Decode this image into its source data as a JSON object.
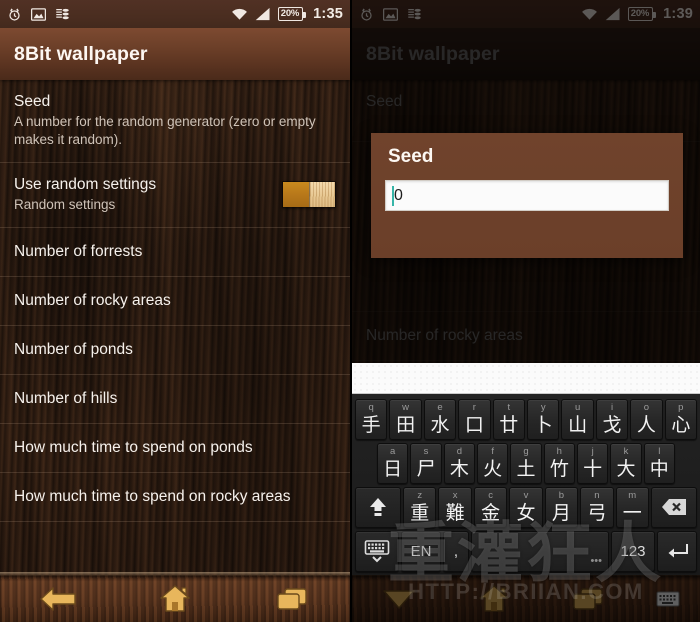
{
  "theme": {
    "accent_brown": "#6d4029",
    "wood_dark": "#3a2418",
    "toggle_on": "#c98a1e",
    "toggle_thumb": "#e4c38c",
    "caret_teal": "#37b5a8",
    "text_primary": "#f6f1ec",
    "text_secondary": "#cfc3b8"
  },
  "left_panel": {
    "statusbar": {
      "icons": [
        "alarm-clock-icon",
        "gallery-image-icon",
        "data-stack-icon"
      ],
      "wifi_icon": "wifi-icon",
      "signal_icon": "cellular-signal-icon",
      "battery_label": "20%",
      "clock": "1:35"
    },
    "titlebar": {
      "title": "8Bit wallpaper"
    },
    "prefs": [
      {
        "title": "Seed",
        "summary": "A number for the random generator (zero or empty makes it random).",
        "widget": "none"
      },
      {
        "title": "Use random settings",
        "summary": "Random settings",
        "widget": "switch",
        "switch_on": true
      },
      {
        "title": "Number of forrests",
        "summary": "",
        "widget": "none"
      },
      {
        "title": "Number of rocky areas",
        "summary": "",
        "widget": "none"
      },
      {
        "title": "Number of ponds",
        "summary": "",
        "widget": "none"
      },
      {
        "title": "Number of hills",
        "summary": "",
        "widget": "none"
      },
      {
        "title": "How much time to spend on ponds",
        "summary": "",
        "widget": "none"
      },
      {
        "title": "How much time to spend on rocky areas",
        "summary": "",
        "widget": "none"
      }
    ],
    "navbar": {
      "back_icon": "back-arrow-icon",
      "home_icon": "home-icon",
      "recents_icon": "recent-apps-icon"
    }
  },
  "right_panel": {
    "statusbar": {
      "icons": [
        "alarm-clock-icon",
        "gallery-image-icon",
        "data-stack-icon"
      ],
      "wifi_icon": "wifi-icon",
      "signal_icon": "cellular-signal-icon",
      "battery_label": "20%",
      "clock": "1:39"
    },
    "titlebar": {
      "title": "8Bit wallpaper"
    },
    "prefs": [
      {
        "title": "Seed",
        "summary": "",
        "widget": "none"
      },
      {
        "title": "Number of rocky areas",
        "summary": "",
        "widget": "none"
      }
    ],
    "dialog": {
      "title": "Seed",
      "input_value": "0",
      "input_placeholder": ""
    },
    "keyboard": {
      "layout_name": "cangjie",
      "suggestion_bar": "",
      "rows": [
        [
          {
            "sub": "q",
            "main": "手"
          },
          {
            "sub": "w",
            "main": "田"
          },
          {
            "sub": "e",
            "main": "水"
          },
          {
            "sub": "r",
            "main": "口"
          },
          {
            "sub": "t",
            "main": "廿"
          },
          {
            "sub": "y",
            "main": "卜"
          },
          {
            "sub": "u",
            "main": "山"
          },
          {
            "sub": "i",
            "main": "戈"
          },
          {
            "sub": "o",
            "main": "人"
          },
          {
            "sub": "p",
            "main": "心"
          }
        ],
        [
          {
            "sub": "a",
            "main": "日"
          },
          {
            "sub": "s",
            "main": "尸"
          },
          {
            "sub": "d",
            "main": "木"
          },
          {
            "sub": "f",
            "main": "火"
          },
          {
            "sub": "g",
            "main": "土"
          },
          {
            "sub": "h",
            "main": "竹"
          },
          {
            "sub": "j",
            "main": "十"
          },
          {
            "sub": "k",
            "main": "大"
          },
          {
            "sub": "l",
            "main": "中"
          }
        ],
        [
          {
            "sub": "",
            "main": "⬆",
            "fn": "shift-key"
          },
          {
            "sub": "z",
            "main": "重"
          },
          {
            "sub": "x",
            "main": "難"
          },
          {
            "sub": "c",
            "main": "金"
          },
          {
            "sub": "v",
            "main": "女"
          },
          {
            "sub": "b",
            "main": "月"
          },
          {
            "sub": "n",
            "main": "弓"
          },
          {
            "sub": "m",
            "main": "一"
          },
          {
            "sub": "",
            "main": "⌫",
            "fn": "backspace-key"
          }
        ],
        [
          {
            "sub": "",
            "main": "⌨",
            "fn": "switch-keyboard-key"
          },
          {
            "sub": "",
            "main": "EN",
            "fn": "language-key"
          },
          {
            "sub": "",
            "main": ",",
            "fn": "comma-key"
          },
          {
            "sub": "",
            "main": "",
            "fn": "space-key"
          },
          {
            "sub": "",
            "main": "123",
            "fn": "numbers-key"
          },
          {
            "sub": "",
            "main": "↵",
            "fn": "enter-key"
          }
        ]
      ]
    },
    "navbar": {
      "back_icon": "hide-keyboard-down-arrow-icon",
      "home_icon": "home-icon",
      "recents_icon": "recent-apps-icon",
      "ime_icon": "keyboard-indicator-icon"
    },
    "watermark": {
      "cjk": "重灌狂人",
      "url": "HTTP://BRIIAN.COM"
    }
  }
}
